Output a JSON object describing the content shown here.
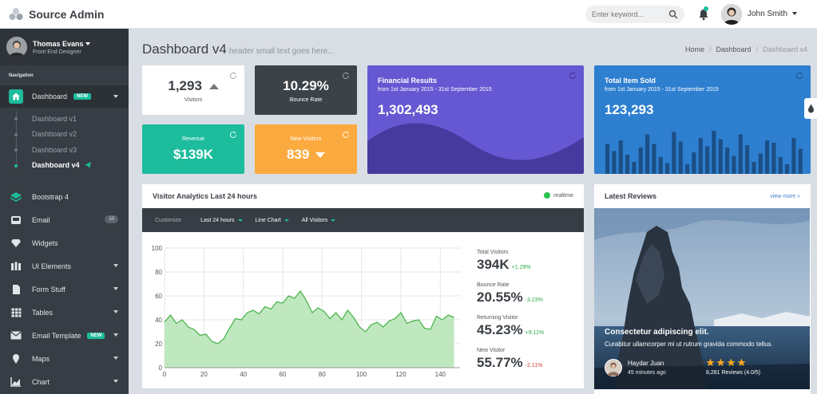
{
  "app": {
    "title": "Source Admin"
  },
  "header": {
    "search_placeholder": "Enter keyword...",
    "user_name": "John Smith"
  },
  "sidebar": {
    "user_name": "Thomas Evans",
    "user_role": "Front End Designer",
    "nav_heading": "Navigation",
    "dashboard": {
      "label": "Dashboard",
      "badge": "NEW"
    },
    "submenu": [
      "Dashboard v1",
      "Dashboard v2",
      "Dashboard v3",
      "Dashboard v4"
    ],
    "items": [
      {
        "label": "Bootstrap 4"
      },
      {
        "label": "Email",
        "count": "10"
      },
      {
        "label": "Widgets"
      },
      {
        "label": "UI Elements"
      },
      {
        "label": "Form Stuff"
      },
      {
        "label": "Tables"
      },
      {
        "label": "Email Template",
        "badge": "NEW"
      },
      {
        "label": "Maps"
      },
      {
        "label": "Chart"
      }
    ]
  },
  "page": {
    "title": "Dashboard v4",
    "subtitle": "header small text goes here...",
    "breadcrumb": [
      "Home",
      "Dashboard",
      "Dashboard v4"
    ]
  },
  "stats": {
    "visitors": {
      "value": "1,293",
      "label": "Visitors"
    },
    "bounce": {
      "value": "10.29%",
      "label": "Bounce Rate"
    },
    "revenue": {
      "label": "Revenue",
      "value": "$139K"
    },
    "new_visitors": {
      "label": "New Visitors",
      "value": "839"
    }
  },
  "financial": {
    "title": "Financial Results",
    "range": "from 1st January 2015 - 31st September 2015",
    "value": "1,302,493"
  },
  "items_sold": {
    "title": "Total Item Sold",
    "range": "from 1st January 2015 - 31st September 2015",
    "value": "123,293",
    "bars": [
      0.5,
      0.38,
      0.56,
      0.32,
      0.2,
      0.44,
      0.66,
      0.5,
      0.28,
      0.18,
      0.7,
      0.54,
      0.16,
      0.36,
      0.6,
      0.46,
      0.72,
      0.58,
      0.44,
      0.3,
      0.66,
      0.48,
      0.2,
      0.34,
      0.56,
      0.52,
      0.28,
      0.16,
      0.6,
      0.42
    ]
  },
  "analytics": {
    "title": "Visitor Analytics Last 24 hours",
    "realtime_label": "realtime",
    "filters": {
      "customize": "Customize",
      "period": "Last 24 hours",
      "chart_type": "Line Chart",
      "audience": "All Visitors"
    },
    "metrics": [
      {
        "label": "Total Visitors",
        "value": "394K",
        "change": "+1.29%",
        "color": "#27a844"
      },
      {
        "label": "Bounce Rate",
        "value": "20.55%",
        "change": "-3.23%",
        "color": "#27a844"
      },
      {
        "label": "Returning Visitor",
        "value": "45.23%",
        "change": "+9.11%",
        "color": "#27a844"
      },
      {
        "label": "New Visitor",
        "value": "55.77%",
        "change": "-2.11%",
        "color": "#d23b3b"
      }
    ]
  },
  "chart_data": {
    "type": "area",
    "xlim": [
      0,
      150
    ],
    "ylim": [
      0,
      100
    ],
    "xticks": [
      0,
      20,
      40,
      60,
      80,
      100,
      120,
      140
    ],
    "yticks": [
      0,
      20,
      40,
      60,
      80,
      100
    ],
    "x": [
      0,
      3,
      6,
      9,
      12,
      15,
      18,
      21,
      24,
      27,
      30,
      33,
      36,
      39,
      42,
      45,
      48,
      51,
      54,
      57,
      60,
      63,
      66,
      69,
      72,
      75,
      78,
      81,
      84,
      87,
      90,
      93,
      96,
      99,
      102,
      105,
      108,
      111,
      114,
      117,
      120,
      123,
      126,
      129,
      132,
      135,
      138,
      141,
      144,
      147
    ],
    "y": [
      38,
      44,
      37,
      40,
      34,
      32,
      27,
      28,
      22,
      20,
      24,
      33,
      41,
      40,
      46,
      48,
      45,
      51,
      49,
      55,
      54,
      60,
      58,
      64,
      56,
      46,
      50,
      47,
      41,
      46,
      40,
      48,
      42,
      34,
      30,
      36,
      38,
      34,
      39,
      41,
      46,
      37,
      39,
      40,
      33,
      32,
      43,
      40,
      44,
      42
    ]
  },
  "reviews": {
    "title": "Latest Reviews",
    "view_more": "view more",
    "headline": "Consectetur adipiscing elit.",
    "text": "Curabitur ullamcorper mi ut rutrum gravida commodo tellus.",
    "reviewer": "Haydar Juan",
    "time": "45 minutes ago",
    "rating": 4,
    "reviews_count": "8,281 Reviews (4.0/5)"
  },
  "colors": {
    "teal": "#1cbc9c",
    "dark": "#3b4248",
    "orange": "#fbaa3f",
    "purple": "#6658d2",
    "blue": "#2e7fd0"
  }
}
